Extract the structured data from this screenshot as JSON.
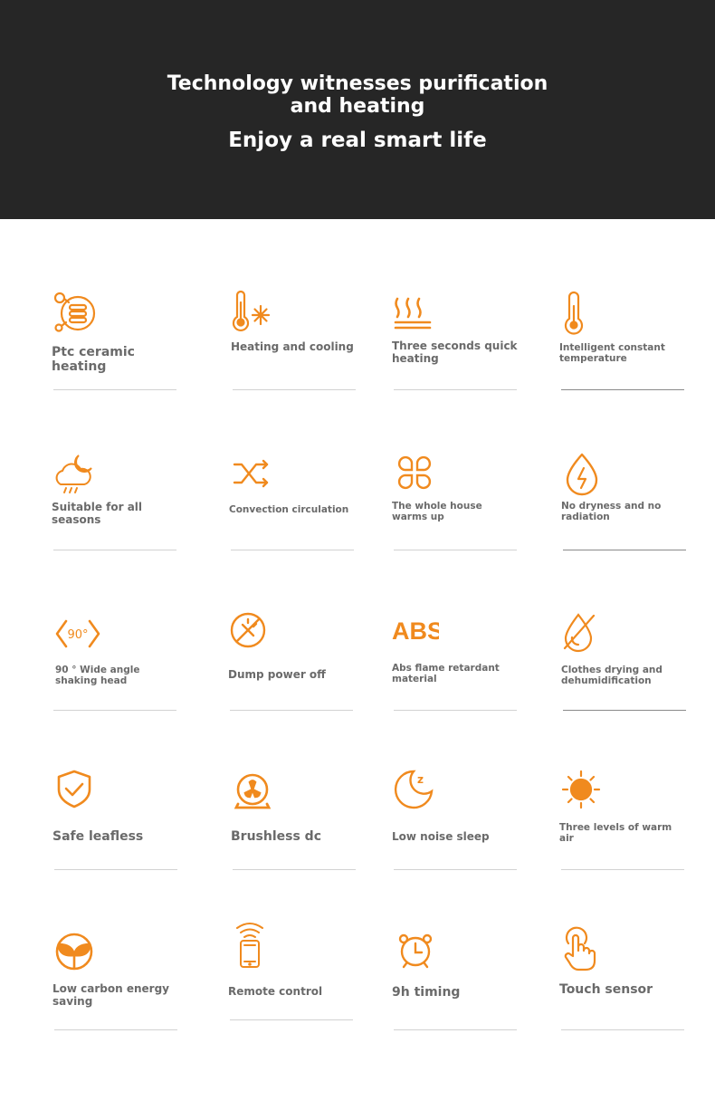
{
  "hero": {
    "title": "Technology witnesses purification and heating",
    "subtitle": "Enjoy a real smart life"
  },
  "colors": {
    "accent": "#f08a1e",
    "hero_bg": "#262626",
    "label": "#6a6a6a"
  },
  "features": [
    {
      "label": "Ptc ceramic heating",
      "icon": "ptc-heater-icon"
    },
    {
      "label": "Heating and cooling",
      "icon": "thermometer-snowflake-icon"
    },
    {
      "label": "Three seconds quick heating",
      "icon": "heat-waves-icon"
    },
    {
      "label": "Intelligent constant temperature",
      "icon": "thermometer-icon"
    },
    {
      "label": "Suitable for all seasons",
      "icon": "weather-cloud-icon"
    },
    {
      "label": "Convection circulation",
      "icon": "shuffle-arrows-icon"
    },
    {
      "label": "The whole house warms up",
      "icon": "four-petal-icon"
    },
    {
      "label": "No dryness and no radiation",
      "icon": "droplet-lightning-icon"
    },
    {
      "label": "90 ° Wide angle shaking head",
      "icon": "angle-90-icon"
    },
    {
      "label": "Dump power off",
      "icon": "tip-over-switch-icon"
    },
    {
      "label": "Abs flame retardant material",
      "icon": "abs-text-icon",
      "icon_text": "ABS"
    },
    {
      "label": "Clothes drying and dehumidification",
      "icon": "no-humidity-drop-icon"
    },
    {
      "label": "Safe leafless",
      "icon": "shield-check-icon"
    },
    {
      "label": "Brushless dc",
      "icon": "fan-motor-icon"
    },
    {
      "label": "Low noise sleep",
      "icon": "moon-sleep-icon",
      "icon_text": "z"
    },
    {
      "label": "Three levels of warm air",
      "icon": "sun-icon"
    },
    {
      "label": "Low carbon energy saving",
      "icon": "eco-leaf-icon"
    },
    {
      "label": "Remote control",
      "icon": "phone-remote-icon"
    },
    {
      "label": "9h timing",
      "icon": "alarm-clock-icon"
    },
    {
      "label": "Touch sensor",
      "icon": "touch-finger-icon"
    }
  ]
}
